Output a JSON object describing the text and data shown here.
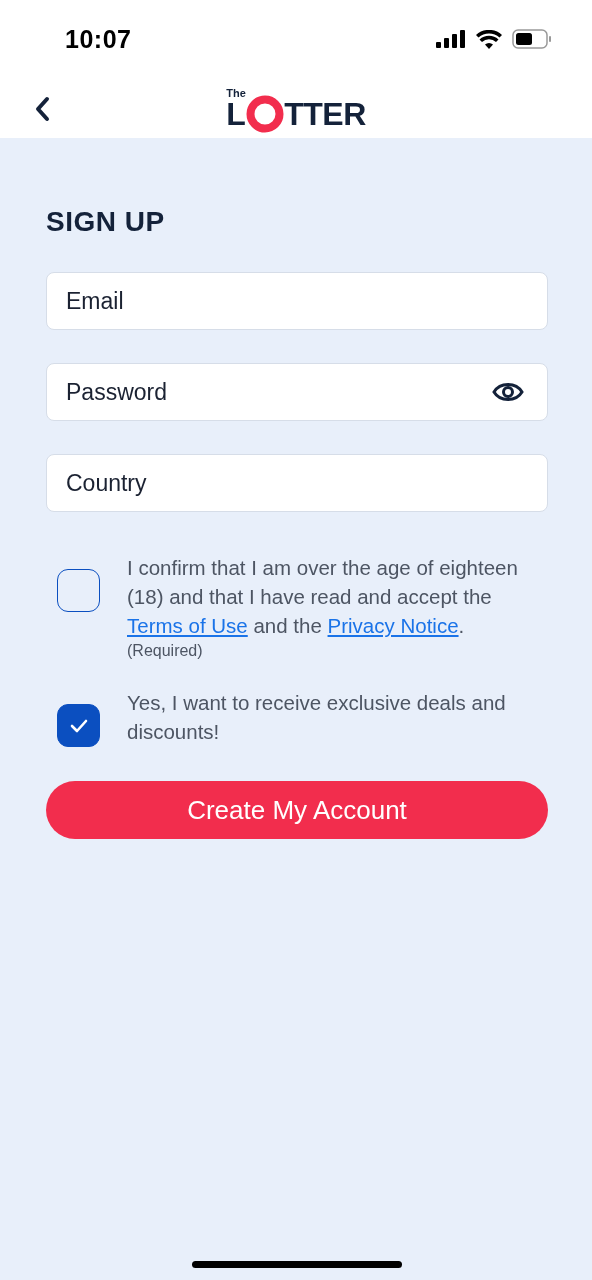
{
  "status_bar": {
    "time": "10:07"
  },
  "header": {
    "logo": {
      "small": "The",
      "left": "L",
      "right": "TTER"
    }
  },
  "title": "SIGN UP",
  "fields": [
    {
      "placeholder": "Email",
      "kind": "text"
    },
    {
      "placeholder": "Password",
      "kind": "password"
    },
    {
      "placeholder": "Country",
      "kind": "text"
    }
  ],
  "consents": [
    {
      "checked": false,
      "parts": [
        {
          "text": "I confirm that I am over the age of eighteen (18) and that I have read and accept the ",
          "link": false
        },
        {
          "text": "Terms of Use",
          "link": true
        },
        {
          "text": " and the ",
          "link": false
        },
        {
          "text": "Privacy Notice",
          "link": true
        },
        {
          "text": ".",
          "link": false
        }
      ],
      "note": "(Required)"
    },
    {
      "checked": true,
      "parts": [
        {
          "text": "Yes, I want to receive exclusive deals and discounts!",
          "link": false
        }
      ]
    }
  ],
  "submit": "Create My Account"
}
